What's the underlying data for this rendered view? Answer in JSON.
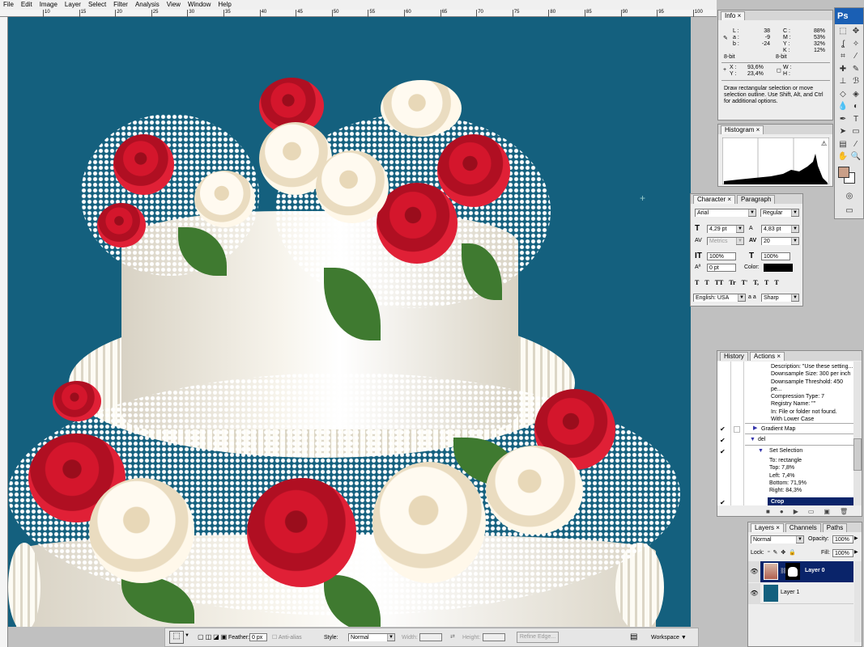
{
  "menu": [
    "File",
    "Edit",
    "Image",
    "Layer",
    "Select",
    "Filter",
    "Analysis",
    "View",
    "Window",
    "Help"
  ],
  "ruler": {
    "top_labels": [
      "10",
      "15",
      "20",
      "25",
      "30",
      "35",
      "40",
      "45",
      "50",
      "55",
      "60",
      "65",
      "70",
      "75",
      "80",
      "85",
      "90",
      "95",
      "100"
    ]
  },
  "info": {
    "tab": "Info",
    "L": "38",
    "a": "-9",
    "b": "-24",
    "C": "88%",
    "M": "53%",
    "Y": "32%",
    "K": "12%",
    "bits_left": "8-bit",
    "bits_right": "8-bit",
    "X": "93,6%",
    "Yc": "23,4%",
    "W": "",
    "H": "",
    "labels": {
      "L": "L :",
      "a": "a :",
      "b": "b :",
      "C": "C :",
      "M": "M :",
      "Y": "Y :",
      "K": "K :",
      "X": "X :",
      "Yc": "Y :",
      "W": "W :",
      "H": "H :"
    },
    "hint": "Draw rectangular selection or move selection outline.  Use Shift, Alt, and Ctrl for additional options."
  },
  "histogram": {
    "tab": "Histogram"
  },
  "character": {
    "tabs": [
      "Character",
      "Paragraph"
    ],
    "font": "Arial",
    "style": "Regular",
    "size": "4,29 pt",
    "leading": "4,83 pt",
    "kerning": "Metrics",
    "tracking": "20",
    "vscale": "100%",
    "hscale": "100%",
    "baseline": "0 pt",
    "color_label": "Color:",
    "language": "English: USA",
    "aa_label": "a a",
    "antialias": "Sharp",
    "styles": [
      "T",
      "T",
      "TT",
      "Tr",
      "T'",
      "T,",
      "T",
      "T"
    ]
  },
  "actions": {
    "tabs": [
      "History",
      "Actions"
    ],
    "items": [
      "Description:  \"Use these setting...",
      "Downsample Size: 300 per inch",
      "Downsample Threshold: 450 pe...",
      "Compression Type: 7",
      "Registry Name:  \"\"",
      "In: File or folder not found.",
      "With Lower Case"
    ],
    "gradient_map": "Gradient Map",
    "del": "del",
    "set_selection": "Set Selection",
    "sel_items": [
      "To: rectangle",
      "Top: 7,8%",
      "Left: 7,4%",
      "Bottom: 71,9%",
      "Right: 84,3%"
    ],
    "crop": "Crop"
  },
  "layers": {
    "tabs": [
      "Layers",
      "Channels",
      "Paths"
    ],
    "blend": "Normal",
    "opacity_label": "Opacity:",
    "opacity": "100%",
    "lock_label": "Lock:",
    "fill_label": "Fill:",
    "fill": "100%",
    "items": [
      {
        "name": "Layer 0",
        "selected": true
      },
      {
        "name": "Layer 1",
        "selected": false
      }
    ]
  },
  "toolbox": {
    "logo": "Ps"
  },
  "options": {
    "feather_label": "Feather:",
    "feather": "0 px",
    "antialias": "Anti-alias",
    "style_label": "Style:",
    "style": "Normal",
    "width_label": "Width:",
    "height_label": "Height:",
    "refine": "Refine Edge...",
    "workspace": "Workspace ▼"
  },
  "colors": {
    "canvas": "#14607e",
    "fg": "#c99f88",
    "selected": "#0a246a"
  }
}
